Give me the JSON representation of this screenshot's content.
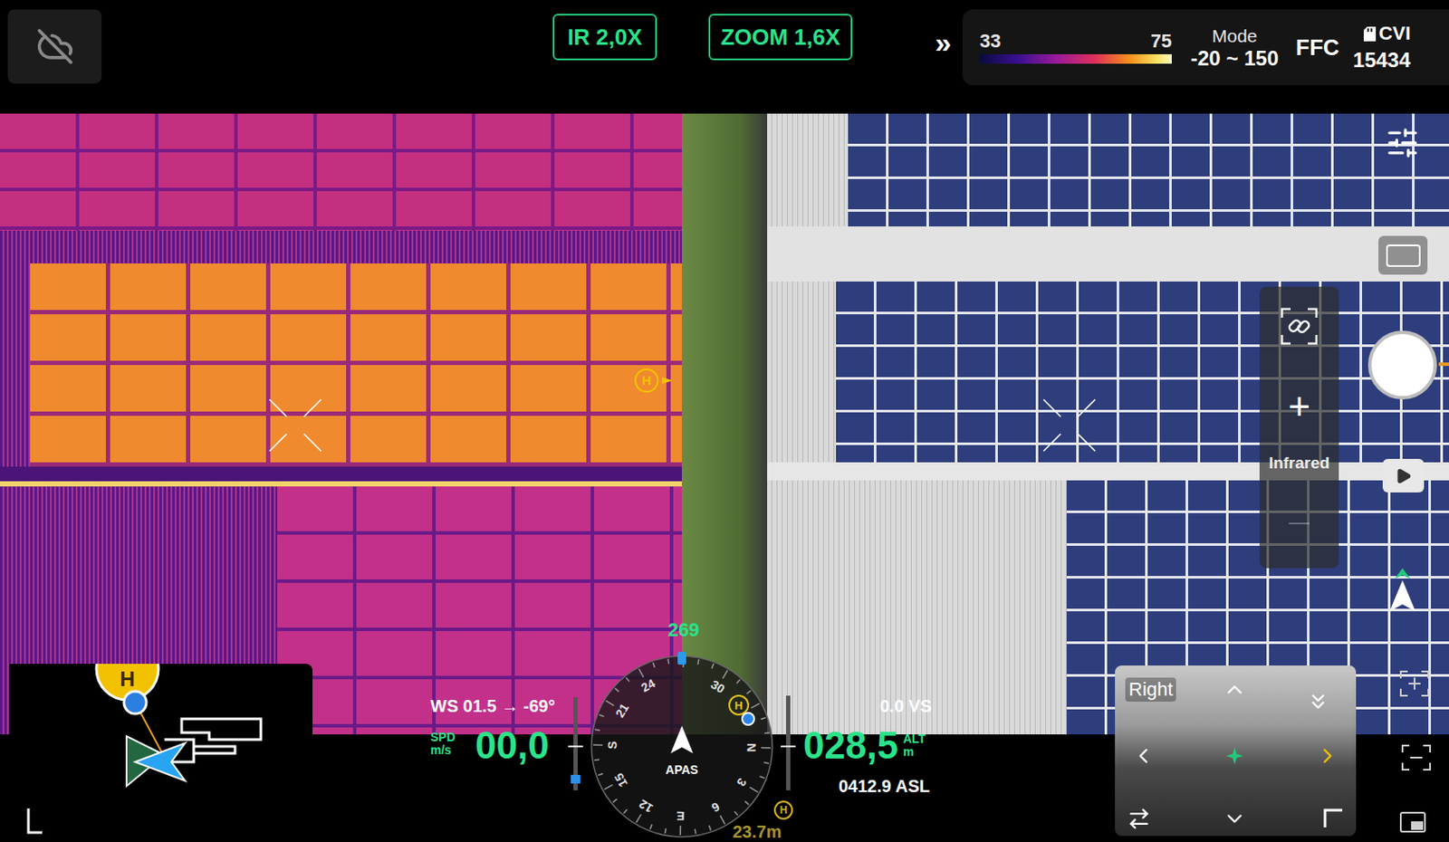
{
  "top_bar": {
    "ir_zoom": "IR 2,0X",
    "zoom": "ZOOM 1,6X",
    "expand": "»",
    "palette": {
      "min": "33",
      "max": "75"
    },
    "mode": {
      "label": "Mode",
      "value": "-20 ~ 150"
    },
    "ffc": "FFC",
    "storage": {
      "label": "CVI",
      "remaining": "15434"
    }
  },
  "camera_controls": {
    "zoom_in": "+",
    "lens": "Infrared"
  },
  "home_marker": "H",
  "flight": {
    "wind": "WS 01.5 → -69°",
    "speed_label": "SPD",
    "speed_unit": "m/s",
    "speed": "00,0",
    "heading": "269",
    "obstacle_mode": "APAS",
    "vertical_speed": "0.0 VS",
    "altitude": "028,5",
    "altitude_label": "ALT",
    "altitude_unit": "m",
    "asl": "0412.9 ASL",
    "home_distance": "23.7m"
  },
  "compass": {
    "marks": [
      {
        "label": "N",
        "bearing": 0
      },
      {
        "label": "3",
        "bearing": 30
      },
      {
        "label": "6",
        "bearing": 60
      },
      {
        "label": "E",
        "bearing": 90
      },
      {
        "label": "12",
        "bearing": 120
      },
      {
        "label": "15",
        "bearing": 150
      },
      {
        "label": "S",
        "bearing": 180
      },
      {
        "label": "21",
        "bearing": 210
      },
      {
        "label": "24",
        "bearing": 240
      },
      {
        "label": "30",
        "bearing": 300
      }
    ]
  },
  "side_view": {
    "label": "Right"
  }
}
